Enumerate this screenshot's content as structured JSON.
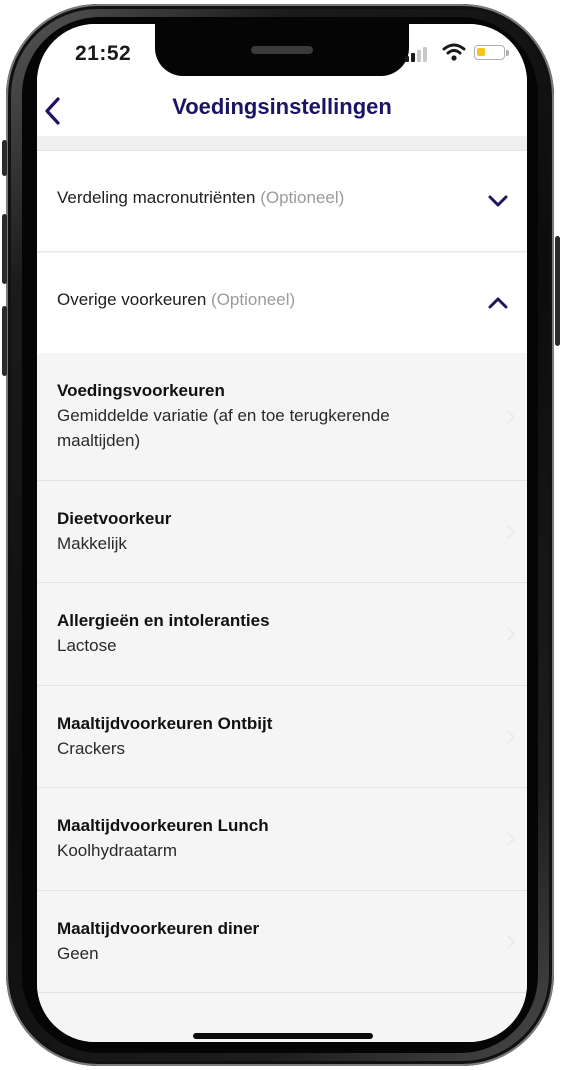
{
  "status_bar": {
    "time": "21:52",
    "battery_level": 0.35
  },
  "header": {
    "title": "Voedingsinstellingen",
    "back_icon": "chevron-left-icon"
  },
  "accordions": [
    {
      "label": "Verdeling macronutriënten",
      "optional": "(Optioneel)",
      "state": "collapsed",
      "icon": "chevron-down-icon"
    },
    {
      "label": "Overige voorkeuren",
      "optional": "(Optioneel)",
      "state": "expanded",
      "icon": "chevron-up-icon"
    }
  ],
  "preferences": [
    {
      "label": "Voedingsvoorkeuren",
      "value": "Gemiddelde variatie (af en toe terugkerende maaltijden)"
    },
    {
      "label": "Dieetvoorkeur",
      "value": "Makkelijk"
    },
    {
      "label": "Allergieën en intoleranties",
      "value": "Lactose"
    },
    {
      "label": "Maaltijdvoorkeuren Ontbijt",
      "value": "Crackers"
    },
    {
      "label": "Maaltijdvoorkeuren Lunch",
      "value": "Koolhydraatarm"
    },
    {
      "label": "Maaltijdvoorkeuren diner",
      "value": "Geen"
    }
  ],
  "colors": {
    "accent": "#1b1464",
    "optional_text": "#9b9b9b",
    "list_background": "#f5f5f6",
    "battery": "#f5c518"
  }
}
